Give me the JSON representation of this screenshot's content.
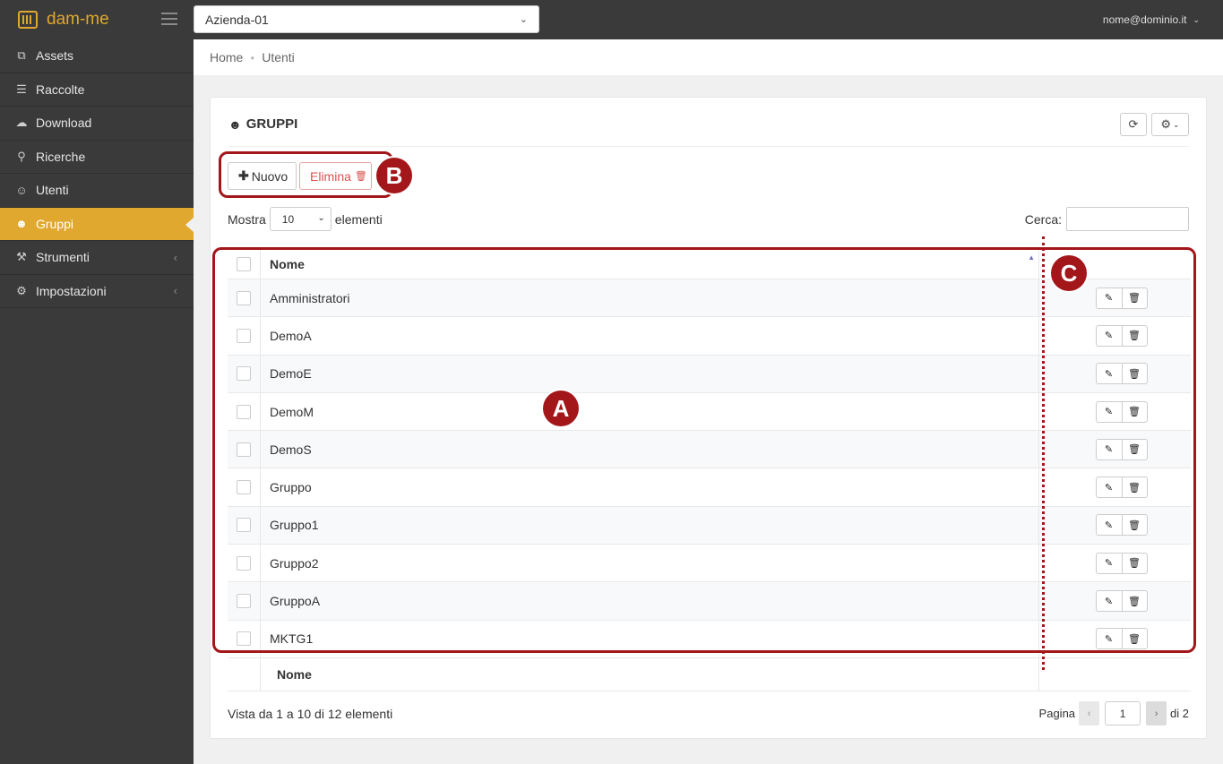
{
  "app": {
    "name": "dam-me",
    "logo_icon": "barcode-box-icon",
    "accent": "#e0a82e"
  },
  "topbar": {
    "company": "Azienda-01",
    "user_email": "nome@dominio.it"
  },
  "sidebar": {
    "items": [
      {
        "label": "Assets",
        "icon": "copy-icon",
        "active": false,
        "has_submenu": false
      },
      {
        "label": "Raccolte",
        "icon": "layers-icon",
        "active": false,
        "has_submenu": false
      },
      {
        "label": "Download",
        "icon": "cloud-download-icon",
        "active": false,
        "has_submenu": false
      },
      {
        "label": "Ricerche",
        "icon": "search-icon",
        "active": false,
        "has_submenu": false
      },
      {
        "label": "Utenti",
        "icon": "user-icon",
        "active": false,
        "has_submenu": false
      },
      {
        "label": "Gruppi",
        "icon": "users-icon",
        "active": true,
        "has_submenu": false
      },
      {
        "label": "Strumenti",
        "icon": "wrench-icon",
        "active": false,
        "has_submenu": true
      },
      {
        "label": "Impostazioni",
        "icon": "gear-icon",
        "active": false,
        "has_submenu": true
      }
    ]
  },
  "breadcrumb": {
    "home": "Home",
    "current": "Utenti"
  },
  "panel": {
    "title": "GRUPPI",
    "new_label": "Nuovo",
    "delete_label": "Elimina",
    "show_prefix": "Mostra",
    "show_value": "10",
    "show_suffix": "elementi",
    "search_label": "Cerca:",
    "column_name": "Nome",
    "footer_column_name": "Nome",
    "info": "Vista da 1 a 10 di 12 elementi",
    "pager": {
      "label": "Pagina",
      "page": "1",
      "total": "di 2"
    }
  },
  "groups": [
    "Amministratori",
    "DemoA",
    "DemoE",
    "DemoM",
    "DemoS",
    "Gruppo",
    "Gruppo1",
    "Gruppo2",
    "GruppoA",
    "MKTG1"
  ],
  "annotations": {
    "a": "A",
    "b": "B",
    "c": "C",
    "color": "#a3161a"
  }
}
